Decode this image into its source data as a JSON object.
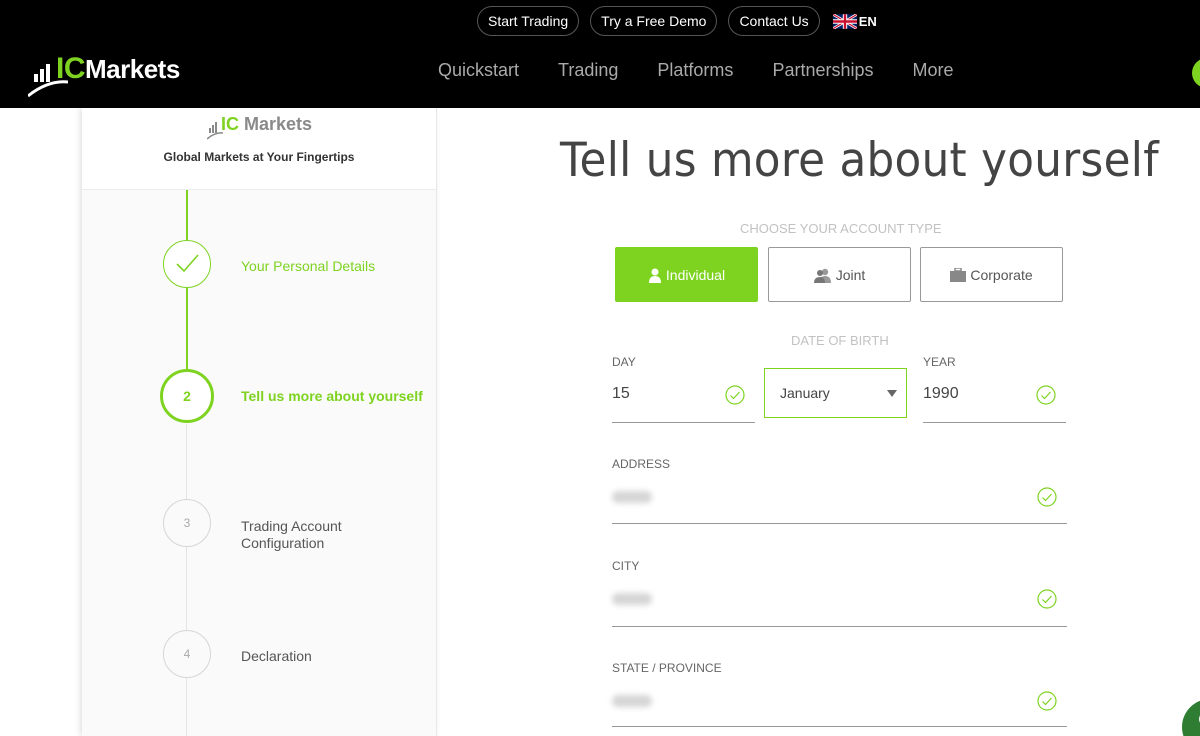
{
  "header": {
    "top_links": [
      "Start Trading",
      "Try a Free Demo",
      "Contact Us"
    ],
    "language": "EN",
    "logo_prefix": "IC",
    "logo_suffix": "Markets",
    "nav": [
      "Quickstart",
      "Trading",
      "Platforms",
      "Partnerships",
      "More"
    ],
    "brand_color": "#7ed321"
  },
  "sidebar": {
    "logo_prefix": "IC",
    "logo_suffix": "Markets",
    "tagline": "Global Markets at Your Fingertips",
    "steps": [
      {
        "number": "",
        "label": "Your Personal Details",
        "status": "done"
      },
      {
        "number": "2",
        "label": "Tell us more about yourself",
        "status": "active"
      },
      {
        "number": "3",
        "label": "Trading Account Configuration",
        "status": "pending"
      },
      {
        "number": "4",
        "label": "Declaration",
        "status": "pending"
      }
    ]
  },
  "form": {
    "title": "Tell us more about yourself",
    "account_type_label": "CHOOSE YOUR ACCOUNT TYPE",
    "account_types": [
      {
        "label": "Individual",
        "icon": "person-icon",
        "selected": true
      },
      {
        "label": "Joint",
        "icon": "people-icon",
        "selected": false
      },
      {
        "label": "Corporate",
        "icon": "briefcase-icon",
        "selected": false
      }
    ],
    "dob_label": "DATE OF BIRTH",
    "day": {
      "label": "DAY",
      "value": "15"
    },
    "month": {
      "value": "January"
    },
    "year": {
      "label": "YEAR",
      "value": "1990"
    },
    "address": {
      "label": "ADDRESS"
    },
    "city": {
      "label": "CITY"
    },
    "state": {
      "label": "STATE / PROVINCE"
    }
  }
}
